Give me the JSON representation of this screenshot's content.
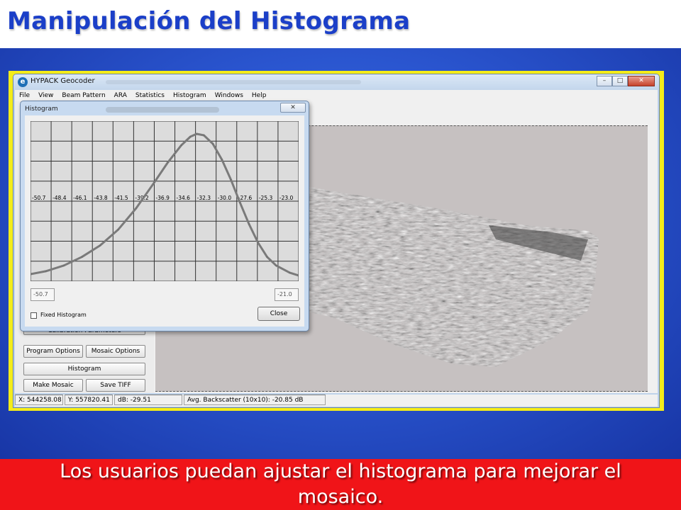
{
  "slide": {
    "title": "Manipulación del Histograma",
    "caption": "Los usuarios puedan ajustar el histograma para mejorar el mosaico."
  },
  "app": {
    "title": "HYPACK Geocoder",
    "icon_glyph": "e",
    "window_controls": {
      "minimize": "–",
      "maximize": "□",
      "close": "✕"
    },
    "menu": [
      "File",
      "View",
      "Beam Pattern",
      "ARA",
      "Statistics",
      "Histogram",
      "Windows",
      "Help"
    ],
    "buttons": {
      "calibration": "Calibration Parameters",
      "program_options": "Program Options",
      "mosaic_options": "Mosaic Options",
      "histogram": "Histogram",
      "make_mosaic": "Make Mosaic",
      "save_tiff": "Save TIFF"
    },
    "status": {
      "x": "X: 544258.08",
      "y": "Y: 557820.41",
      "db": "dB: -29.51",
      "avg": "Avg. Backscatter (10x10): -20.85 dB"
    }
  },
  "histogram_dialog": {
    "title": "Histogram",
    "close_glyph": "✕",
    "min_value": "-50.7",
    "max_value": "-21.0",
    "fixed_label": "Fixed Histogram",
    "fixed_checked": false,
    "close_label": "Close"
  },
  "chart_data": {
    "type": "line",
    "x_tick_labels": [
      "-50.7",
      "-48.4",
      "-46.1",
      "-43.8",
      "-41.5",
      "-39.2",
      "-36.9",
      "-34.6",
      "-32.3",
      "-30.0",
      "-27.6",
      "-25.3",
      "-23.0"
    ],
    "xlim": [
      -50.7,
      -21.0
    ],
    "ylim": [
      0,
      1
    ],
    "grid": true,
    "series": [
      {
        "x": [
          -50.7,
          -49.0,
          -47.0,
          -45.0,
          -43.0,
          -41.0,
          -39.0,
          -37.0,
          -35.5,
          -34.0,
          -33.0,
          -32.3,
          -31.5,
          -30.5,
          -29.5,
          -28.5,
          -27.5,
          -26.5,
          -25.5,
          -24.5,
          -23.5,
          -22.0,
          -21.0
        ],
        "y": [
          0.02,
          0.04,
          0.08,
          0.14,
          0.22,
          0.33,
          0.48,
          0.66,
          0.8,
          0.92,
          0.98,
          1.0,
          0.99,
          0.93,
          0.82,
          0.68,
          0.52,
          0.37,
          0.24,
          0.14,
          0.08,
          0.03,
          0.01
        ]
      }
    ]
  }
}
